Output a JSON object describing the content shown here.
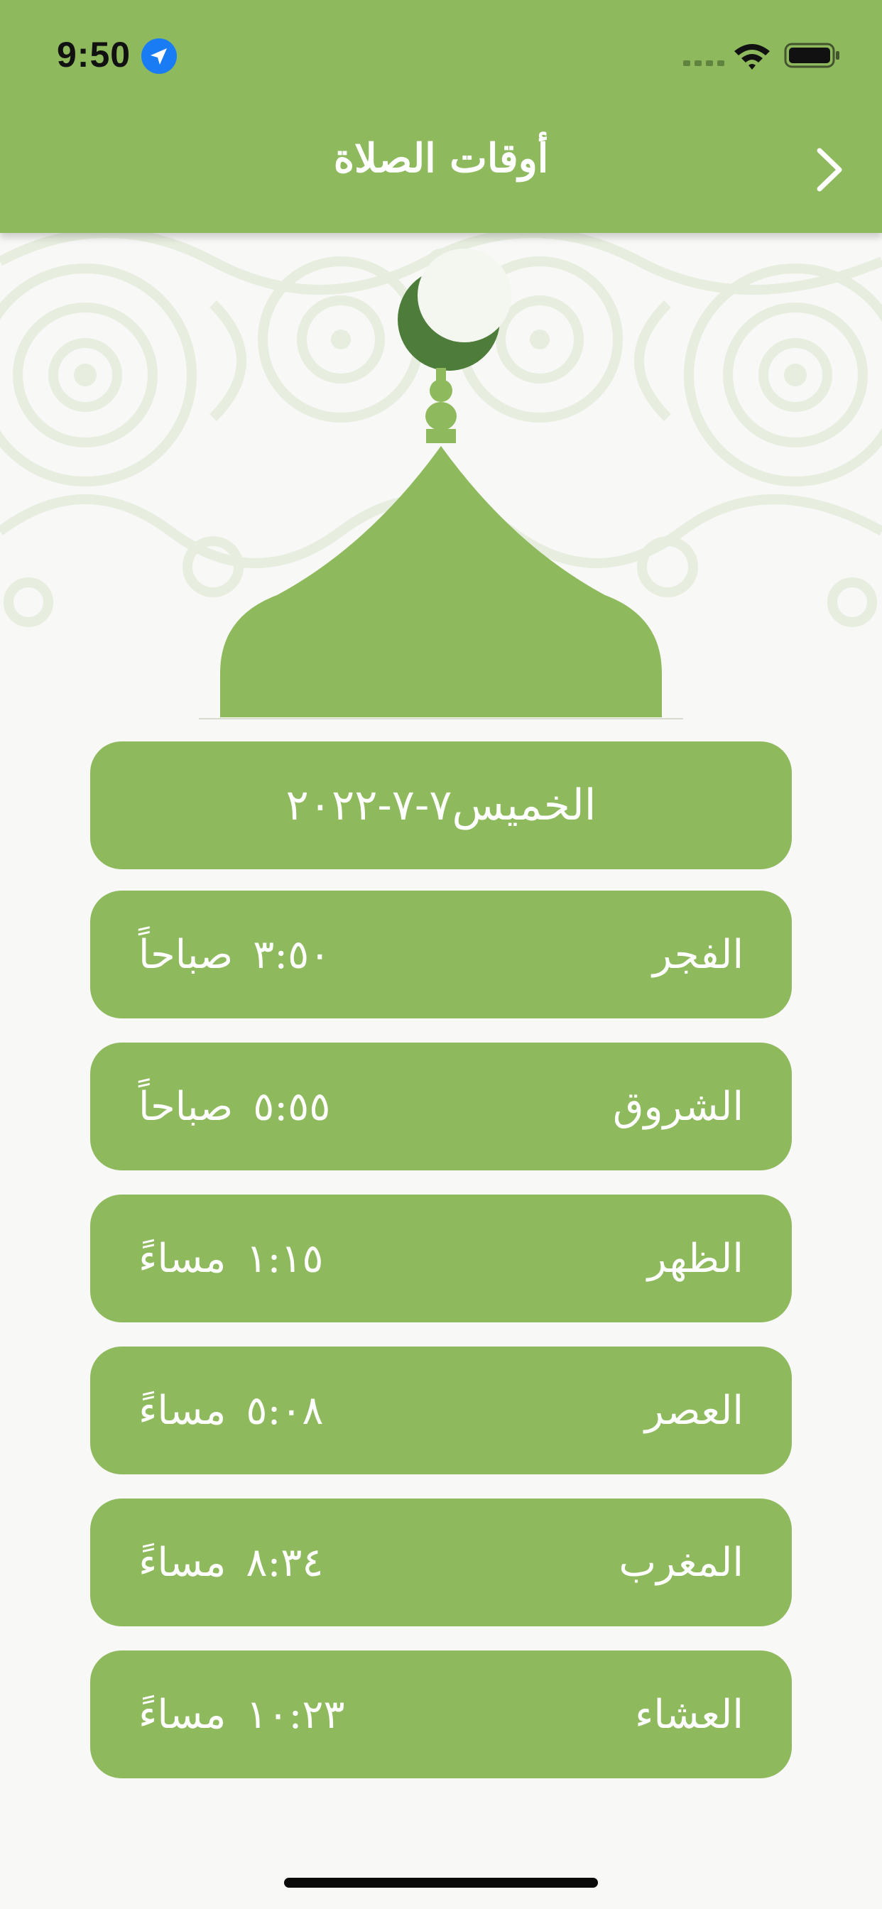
{
  "status_bar": {
    "time": "9:50",
    "location_icon": "location-arrow-icon",
    "signal_icon": "cellular-signal-icon",
    "wifi_icon": "wifi-icon",
    "battery_icon": "battery-icon"
  },
  "nav": {
    "title": "أوقات الصلاة",
    "back_icon": "chevron-right-icon"
  },
  "hero": {
    "icon": "mosque-dome-crescent-icon",
    "colors": {
      "dome": "#8eb95d",
      "crescent": "#4e7d3b",
      "pattern": "#e7eddf"
    }
  },
  "date_card": {
    "text": "الخميس٧-٧-٢٠٢٢"
  },
  "prayers": [
    {
      "name": "الفجر",
      "time": "٣:٥٠",
      "period": "صباحاً"
    },
    {
      "name": "الشروق",
      "time": "٥:٥٥",
      "period": "صباحاً"
    },
    {
      "name": "الظهر",
      "time": "١:١٥",
      "period": "مساءً"
    },
    {
      "name": "العصر",
      "time": "٥:٠٨",
      "period": "مساءً"
    },
    {
      "name": "المغرب",
      "time": "٨:٣٤",
      "period": "مساءً"
    },
    {
      "name": "العشاء",
      "time": "١٠:٢٣",
      "period": "مساءً"
    }
  ],
  "colors": {
    "accent": "#8eb95d",
    "background": "#f8f8f6",
    "text_on_accent": "#ffffff"
  }
}
